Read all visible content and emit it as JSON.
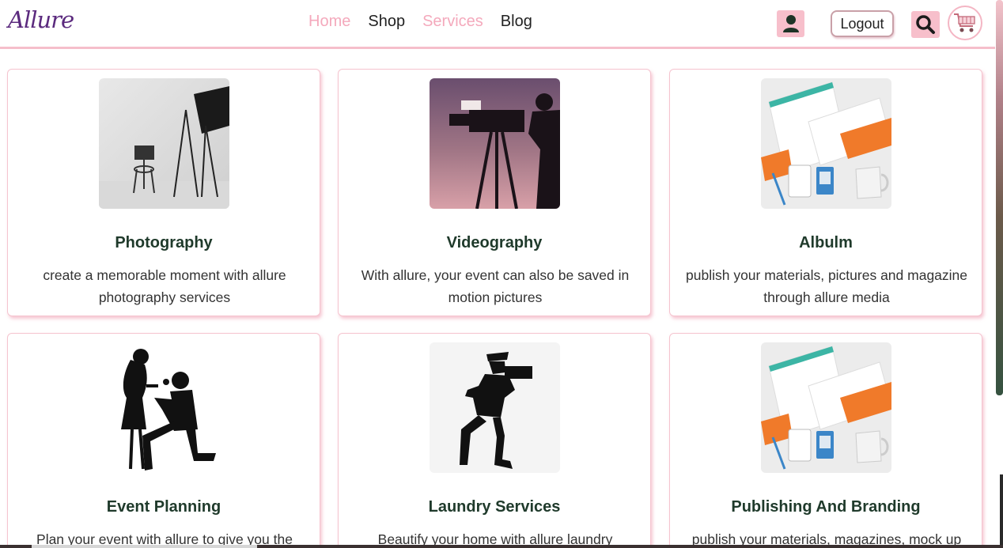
{
  "header": {
    "logo": "Allure",
    "nav": [
      {
        "label": "Home",
        "active": true
      },
      {
        "label": "Shop",
        "active": false
      },
      {
        "label": "Services",
        "active": true
      },
      {
        "label": "Blog",
        "active": false
      }
    ],
    "user_icon": "user-icon",
    "logout_label": "Logout",
    "search_icon": "search-icon",
    "cart_icon": "shopping-cart-icon"
  },
  "colors": {
    "accent_pink": "#f7bfcb",
    "nav_pink": "#f4a9bc",
    "title_green": "#1f3a2b",
    "logo_purple": "#5b2a7e"
  },
  "services": [
    {
      "title": "Photography",
      "description": "create a memorable moment with allure photography services",
      "image": "photo-studio-image"
    },
    {
      "title": "Videography",
      "description": "With allure, your event can also be saved in motion pictures",
      "image": "video-camera-silhouette-image"
    },
    {
      "title": "Albulm",
      "description": "publish your materials, pictures and magazine through allure media",
      "image": "branding-mockup-image"
    },
    {
      "title": "Event Planning",
      "description": "Plan your event with allure to give you the best",
      "image": "proposal-silhouette-image"
    },
    {
      "title": "Laundry Services",
      "description": "Beautify your home with allure laundry",
      "image": "photographer-silhouette-image"
    },
    {
      "title": "Publishing And Branding",
      "description": "publish your materials, magazines, mock up",
      "image": "branding-mockup-image"
    }
  ]
}
